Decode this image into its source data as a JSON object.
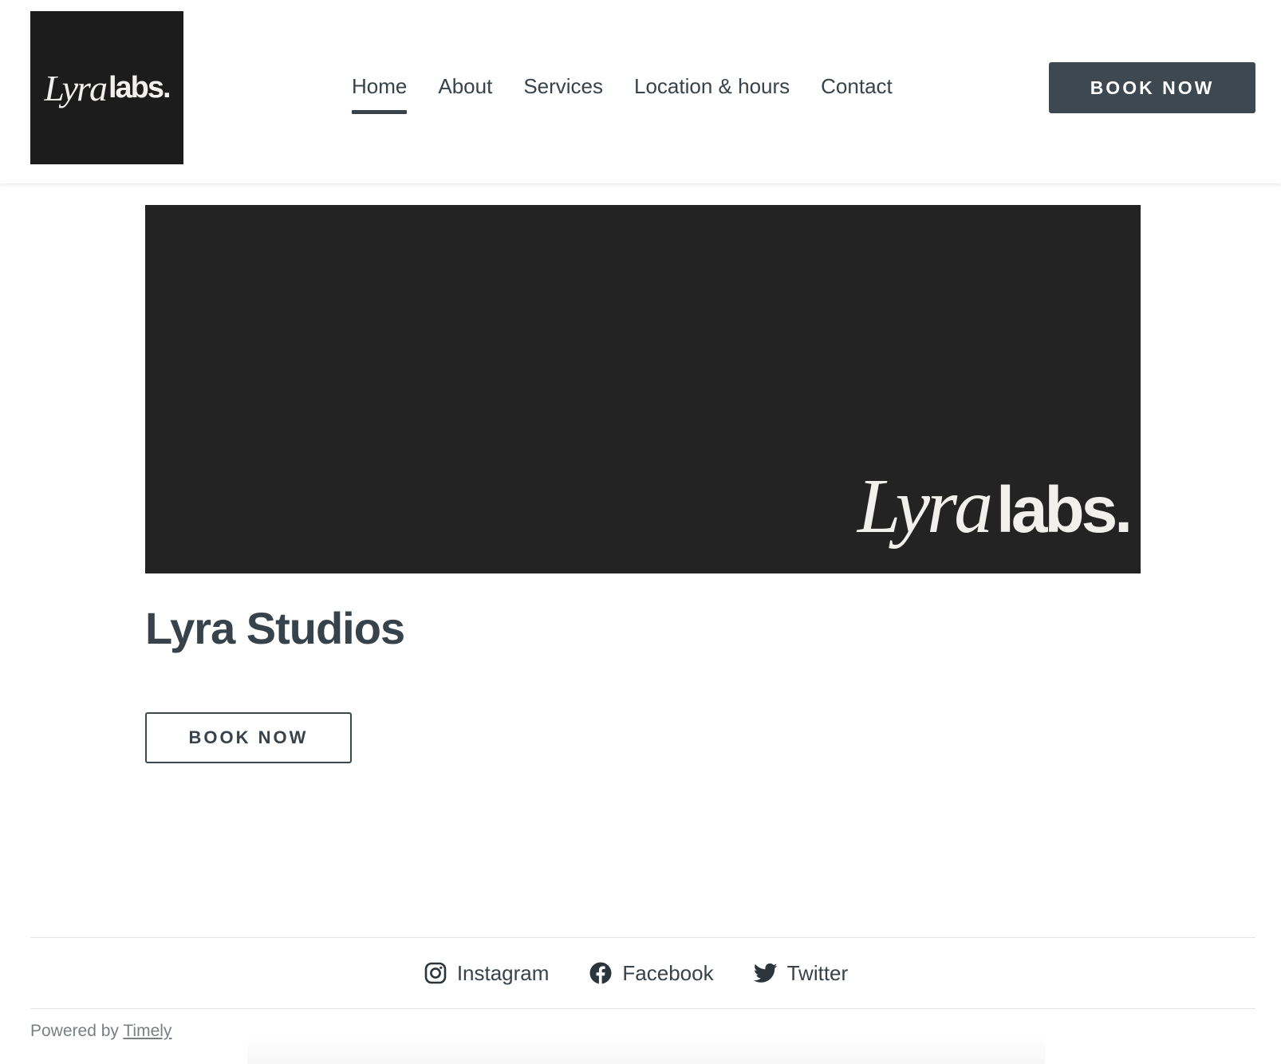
{
  "header": {
    "logo": {
      "script": "Lyra",
      "bold": "labs."
    },
    "nav": [
      {
        "label": "Home",
        "active": true
      },
      {
        "label": "About"
      },
      {
        "label": "Services"
      },
      {
        "label": "Location & hours"
      },
      {
        "label": "Contact"
      }
    ],
    "book_label": "BOOK NOW"
  },
  "hero": {
    "logo": {
      "script": "Lyra",
      "bold": "labs."
    }
  },
  "main": {
    "title": "Lyra Studios",
    "book_label": "BOOK NOW"
  },
  "footer": {
    "social": [
      {
        "label": "Instagram",
        "icon": "instagram-icon"
      },
      {
        "label": "Facebook",
        "icon": "facebook-icon"
      },
      {
        "label": "Twitter",
        "icon": "twitter-icon"
      }
    ],
    "powered_prefix": "Powered by",
    "powered_link": "Timely"
  },
  "colors": {
    "text": "#37424a",
    "button_bg": "#3d4850",
    "hero_bg": "#232323",
    "logo_bg": "#1c1c1c"
  }
}
